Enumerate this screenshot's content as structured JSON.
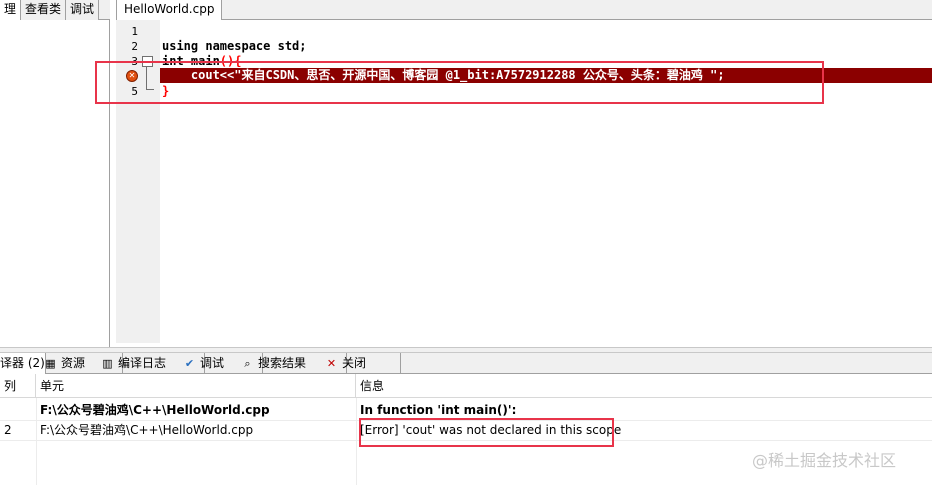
{
  "left_panel": {
    "tabs": [
      {
        "label": "理"
      },
      {
        "label": "查看类"
      },
      {
        "label": "调试"
      }
    ]
  },
  "editor": {
    "tab_label": "HelloWorld.cpp",
    "line_numbers": [
      "1",
      "2",
      "3",
      "4",
      "5"
    ],
    "lines": {
      "l2": "using namespace std;",
      "l3_kw": "int main",
      "l3_punc": "(){",
      "l4": "    cout<<\"来自CSDN、思否、开源中国、博客园 @1_bit:A7572912288 公众号、头条：碧油鸡 \";",
      "l5": "}"
    },
    "error_line_color": "#8b0000"
  },
  "bottom_tabs": [
    {
      "label": "译器 (2)",
      "icon": "compiler-icon"
    },
    {
      "label": "资源",
      "icon": "resource-icon"
    },
    {
      "label": "编译日志",
      "icon": "chart-icon"
    },
    {
      "label": "调试",
      "icon": "check-icon"
    },
    {
      "label": "搜索结果",
      "icon": "search-icon"
    },
    {
      "label": "关闭",
      "icon": "close-icon"
    }
  ],
  "messages": {
    "headers": {
      "col": "列",
      "unit": "单元",
      "info": "信息"
    },
    "rows": [
      {
        "col": "",
        "unit": "F:\\公众号碧油鸡\\C++\\HelloWorld.cpp",
        "info": "In function 'int main()':"
      },
      {
        "col": "2",
        "unit": "F:\\公众号碧油鸡\\C++\\HelloWorld.cpp",
        "info": "[Error] 'cout' was not declared in this scope"
      }
    ]
  },
  "watermark": "@稀土掘金技术社区",
  "highlight_color": "#e8344a"
}
